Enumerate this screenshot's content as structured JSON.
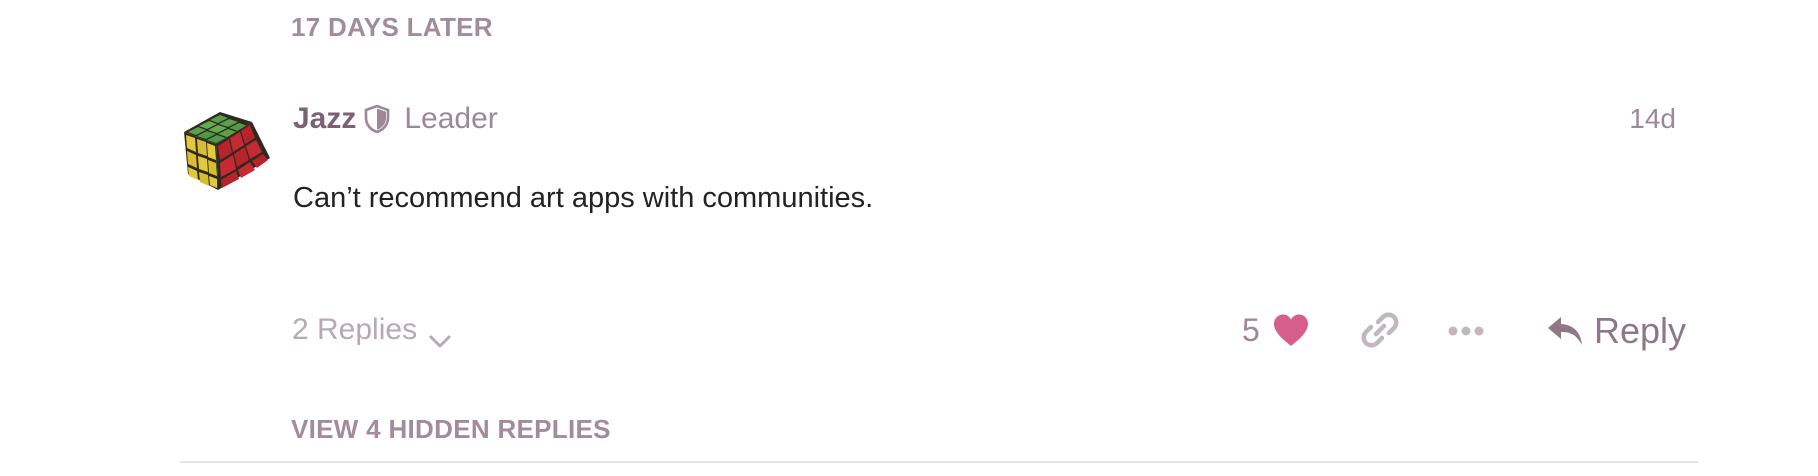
{
  "time_gap": {
    "label": "17 DAYS LATER"
  },
  "post": {
    "author": {
      "name": "Jazz",
      "title": "Leader",
      "avatar_icon": "rubiks-cube-avatar",
      "badge_icon": "shield-icon"
    },
    "date": "14d",
    "body": "Can’t recommend art apps with communities."
  },
  "post_controls": {
    "replies_label": "2 Replies",
    "like_count": "5",
    "reply_label": "Reply",
    "icons": [
      "chevron-down-icon",
      "heart-icon",
      "link-icon",
      "more-icon",
      "reply-arrow-icon"
    ]
  },
  "hidden_replies": {
    "label": "VIEW 4 HIDDEN REPLIES"
  },
  "colors": {
    "heart": "#d55e8c",
    "muted_text": "#9c8896",
    "author_name": "#7b6174",
    "body_text": "#222222"
  }
}
